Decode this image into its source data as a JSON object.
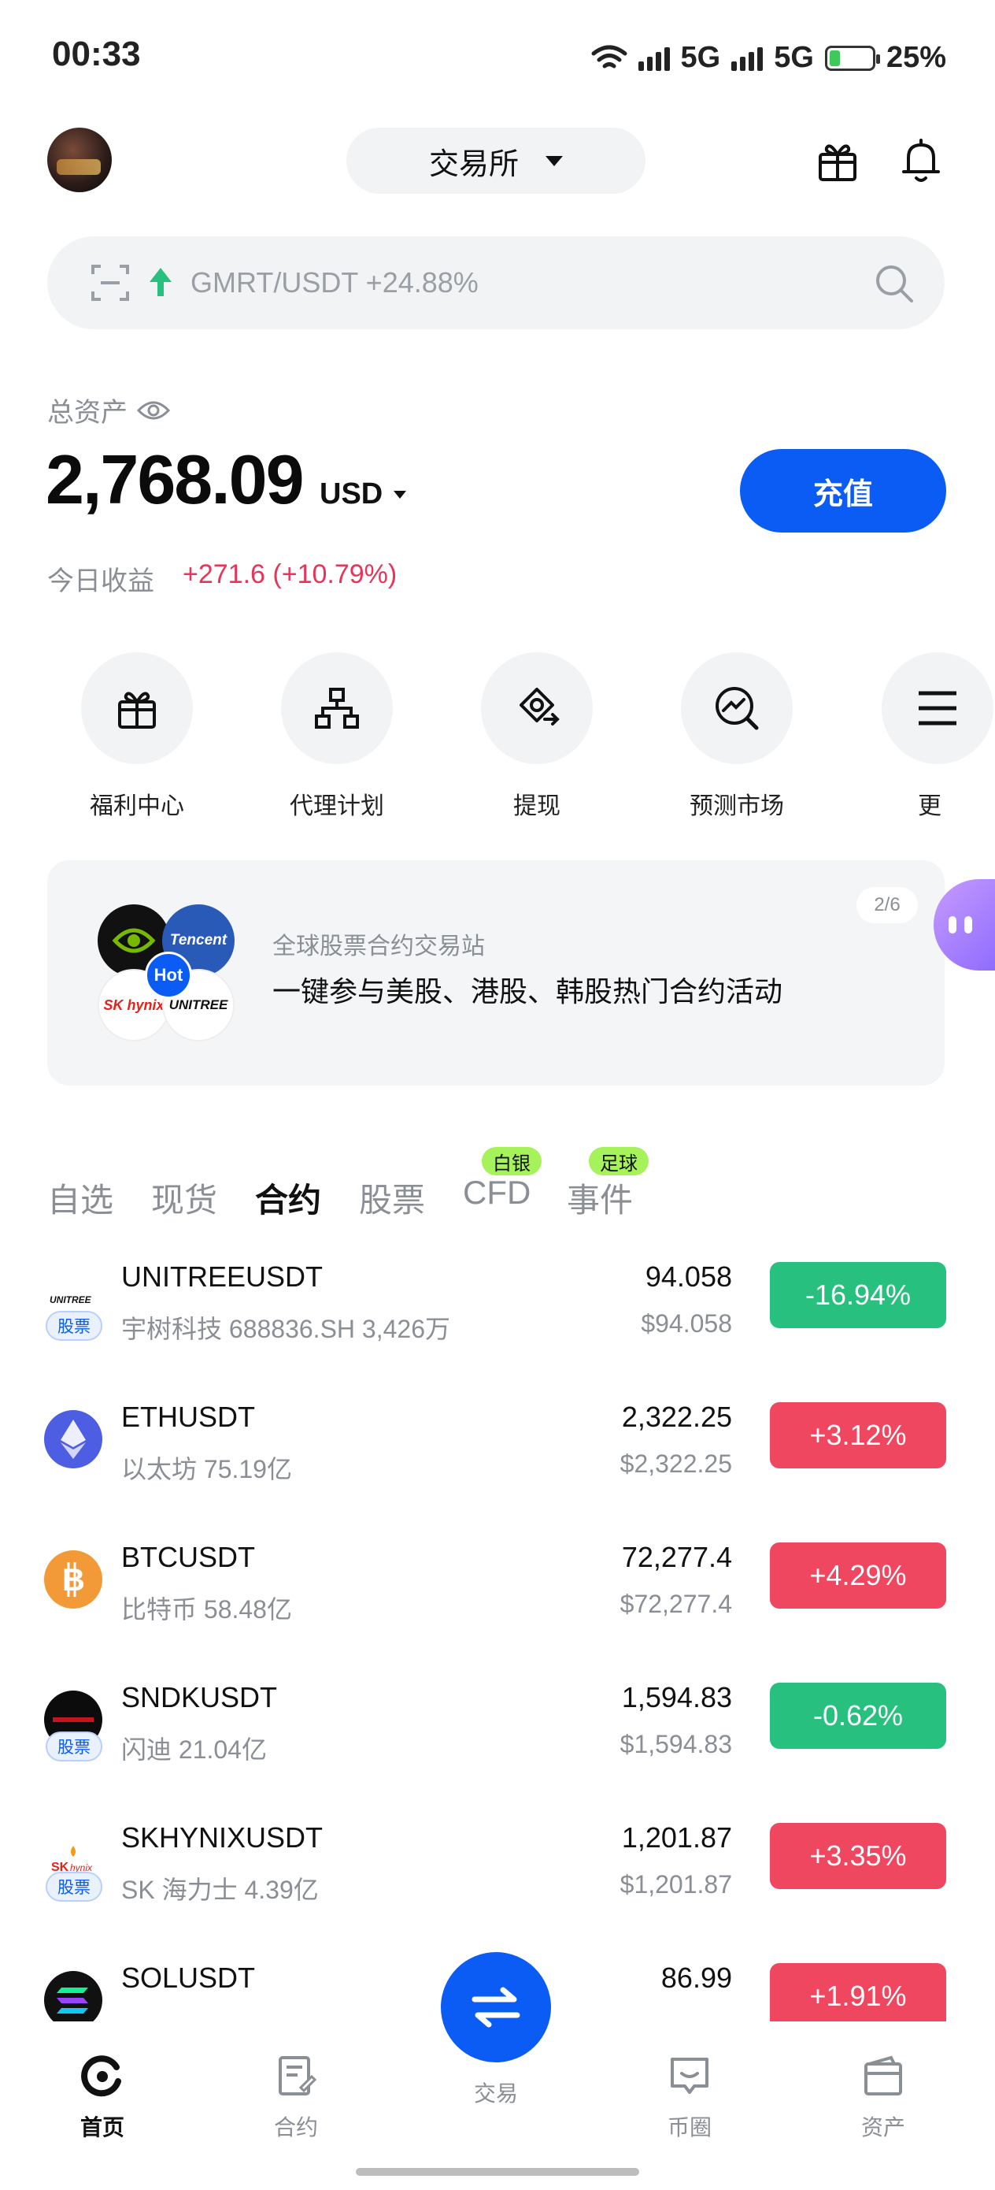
{
  "status_bar": {
    "time": "00:33",
    "network1": "5G",
    "network2": "5G",
    "battery": "25%",
    "battery_level": 0.25
  },
  "header": {
    "exchange_label": "交易所"
  },
  "search": {
    "ticker_text": "GMRT/USDT +24.88%"
  },
  "assets": {
    "label": "总资产",
    "balance": "2,768.09",
    "currency": "USD",
    "deposit_label": "充值",
    "today_label": "今日收益",
    "today_value": "+271.6 (+10.79%)"
  },
  "shortcuts": [
    {
      "label": "福利中心",
      "icon": "gift-icon"
    },
    {
      "label": "代理计划",
      "icon": "org-chart-icon"
    },
    {
      "label": "提现",
      "icon": "withdraw-icon"
    },
    {
      "label": "预测市场",
      "icon": "prediction-icon"
    },
    {
      "label": "更",
      "icon": "more-icon"
    }
  ],
  "banner": {
    "page": "2/6",
    "subtitle": "全球股票合约交易站",
    "title": "一键参与美股、港股、韩股热门合约活动",
    "hot": "Hot",
    "logos": [
      "nvidia",
      "Tencent",
      "SK hynix",
      "UNITREE"
    ]
  },
  "tabs": [
    {
      "label": "自选",
      "active": false
    },
    {
      "label": "现货",
      "active": false
    },
    {
      "label": "合约",
      "active": true
    },
    {
      "label": "股票",
      "active": false
    },
    {
      "label": "CFD",
      "active": false,
      "badge": "白银"
    },
    {
      "label": "事件",
      "active": false,
      "badge": "足球"
    }
  ],
  "markets": [
    {
      "symbol": "UNITREEUSDT",
      "sub": "宇树科技 688836.SH 3,426万",
      "price": "94.058",
      "price_usd": "$94.058",
      "change": "-16.94%",
      "direction": "down",
      "tag": "股票",
      "icon": "unitree-logo-icon"
    },
    {
      "symbol": "ETHUSDT",
      "sub": "以太坊 75.19亿",
      "price": "2,322.25",
      "price_usd": "$2,322.25",
      "change": "+3.12%",
      "direction": "up",
      "icon": "ethereum-icon"
    },
    {
      "symbol": "BTCUSDT",
      "sub": "比特币 58.48亿",
      "price": "72,277.4",
      "price_usd": "$72,277.4",
      "change": "+4.29%",
      "direction": "up",
      "icon": "bitcoin-icon"
    },
    {
      "symbol": "SNDKUSDT",
      "sub": "闪迪 21.04亿",
      "price": "1,594.83",
      "price_usd": "$1,594.83",
      "change": "-0.62%",
      "direction": "down",
      "tag": "股票",
      "icon": "sandisk-logo-icon"
    },
    {
      "symbol": "SKHYNIXUSDT",
      "sub": "SK 海力士 4.39亿",
      "price": "1,201.87",
      "price_usd": "$1,201.87",
      "change": "+3.35%",
      "direction": "up",
      "tag": "股票",
      "icon": "skhynix-logo-icon"
    },
    {
      "symbol": "SOLUSDT",
      "sub": "",
      "price": "86.99",
      "price_usd": "",
      "change": "+1.91%",
      "direction": "up",
      "icon": "solana-icon"
    }
  ],
  "bottom_nav": [
    {
      "label": "首页",
      "icon": "home-icon",
      "active": true
    },
    {
      "label": "合约",
      "icon": "contract-icon",
      "active": false
    },
    {
      "label": "交易",
      "icon": "swap-icon",
      "active": false
    },
    {
      "label": "币圈",
      "icon": "chat-icon",
      "active": false
    },
    {
      "label": "资产",
      "icon": "wallet-icon",
      "active": false
    }
  ],
  "colors": {
    "accent": "#0a5cf5",
    "up": "#f04760",
    "down": "#28c07f",
    "badge": "#a6f25a"
  }
}
